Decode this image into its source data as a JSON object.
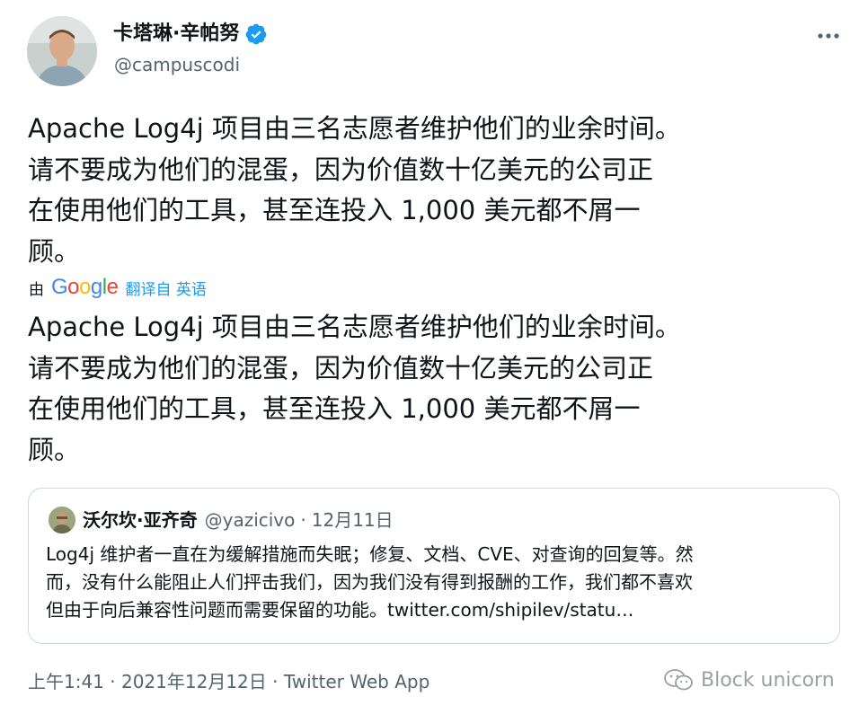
{
  "author": {
    "name": "卡塔琳·辛帕努",
    "handle": "@campuscodi",
    "verified": true,
    "verified_color": "#1d9bf0"
  },
  "more_icon": "more-horizontal-icon",
  "tweet": {
    "original_text": "Apache Log4j 项目由三名志愿者维护他们的业余时间。\n请不要成为他们的混蛋，因为价值数十亿美元的公司正\n在使用他们的工具，甚至连投入 1,000 美元都不屑一\n顾。",
    "translated_text": "Apache Log4j 项目由三名志愿者维护他们的业余时间。\n请不要成为他们的混蛋，因为价值数十亿美元的公司正\n在使用他们的工具，甚至连投入 1,000 美元都不屑一\n顾。",
    "translate_prefix": "由",
    "translate_brand": "Google",
    "translate_link": "翻译自 英语"
  },
  "quote": {
    "name": "沃尔坎·亚齐奇",
    "handle": "@yazicivo",
    "separator": "·",
    "date": "12月11日",
    "text": "Log4j 维护者一直在为缓解措施而失眠；修复、文档、CVE、对查询的回复等。然\n而，没有什么能阻止人们抨击我们，因为我们没有得到报酬的工作，我们都不喜欢\n但由于向后兼容性问题而需要保留的功能。twitter.com/shipilev/statu…"
  },
  "meta": {
    "time_line": "上午1:41 · 2021年12月12日 · Twitter Web App"
  },
  "watermark": {
    "text": "Block unicorn",
    "icon": "wechat-icon"
  },
  "colors": {
    "text": "#0f1419",
    "secondary": "#536471",
    "link": "#1d9bf0",
    "border": "#cfd9de"
  }
}
